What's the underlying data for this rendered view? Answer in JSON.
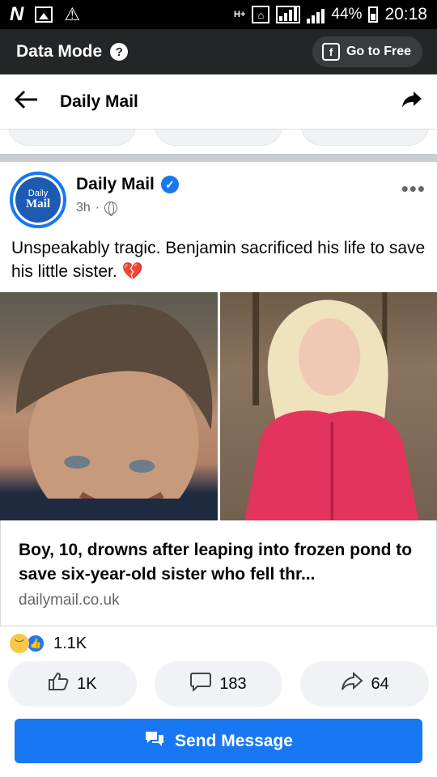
{
  "status_bar": {
    "left_icons": [
      "n-icon",
      "image-icon",
      "warning-icon"
    ],
    "network": "H+",
    "battery": "44%",
    "time": "20:18"
  },
  "data_mode_bar": {
    "title": "Data Mode",
    "help_glyph": "?",
    "go_free_label": "Go to Free"
  },
  "header": {
    "title": "Daily Mail"
  },
  "post": {
    "avatar_line1": "Daily",
    "avatar_line2": "Mail",
    "page_name": "Daily Mail",
    "time": "3h",
    "dot": "·",
    "text": "Unspeakably tragic. Benjamin sacrificed his life to save his little sister.",
    "emoji": "💔"
  },
  "link_card": {
    "title": "Boy, 10, drowns after leaping into frozen pond to save six-year-old sister who fell thr...",
    "domain": "dailymail.co.uk"
  },
  "reactions": {
    "count": "1.1K"
  },
  "actions": {
    "like_count": "1K",
    "comment_count": "183",
    "share_count": "64"
  },
  "send_message": {
    "label": "Send Message"
  },
  "colors": {
    "accent": "#1877f2",
    "dark_bar": "#242526",
    "secondary_text": "#65676b"
  }
}
